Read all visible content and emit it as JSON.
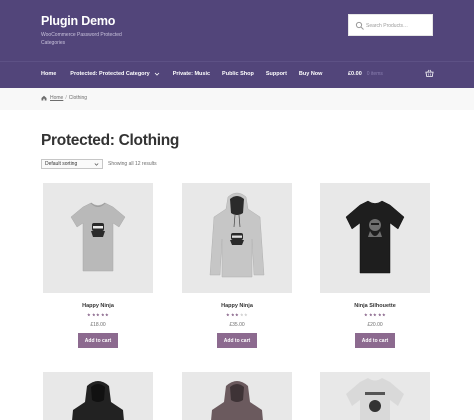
{
  "site": {
    "title": "Plugin Demo",
    "description": "WooCommerce Password Protected Categories"
  },
  "search": {
    "placeholder": "Search Products…"
  },
  "nav": {
    "items": [
      {
        "label": "Home"
      },
      {
        "label": "Protected: Protected Category",
        "has_dropdown": true
      },
      {
        "label": "Private: Music"
      },
      {
        "label": "Public Shop"
      },
      {
        "label": "Support"
      },
      {
        "label": "Buy Now"
      }
    ]
  },
  "cart": {
    "total": "£0.00",
    "count": "0 items",
    "icon": "basket-icon"
  },
  "breadcrumb": {
    "home": "Home",
    "separator": "/",
    "current": "Clothing"
  },
  "page": {
    "title": "Protected: Clothing"
  },
  "sorting": {
    "selected": "Default sorting",
    "result_count": "Showing all 12 results"
  },
  "products": [
    {
      "name": "Happy Ninja",
      "price": "£18.00",
      "rating": 5,
      "button": "Add to cart",
      "shirt_color": "#b9b9b9",
      "type": "tshirt"
    },
    {
      "name": "Happy Ninja",
      "price": "£35.00",
      "rating": 3,
      "button": "Add to cart",
      "shirt_color": "#c6c6c6",
      "type": "hoodie"
    },
    {
      "name": "Ninja Silhouette",
      "price": "£20.00",
      "rating": 5,
      "button": "Add to cart",
      "shirt_color": "#1e1e1e",
      "type": "tshirt"
    }
  ],
  "row2_products": [
    {
      "type": "hoodie",
      "shirt_color": "#222222"
    },
    {
      "type": "hoodie",
      "shirt_color": "#6b5a5e"
    },
    {
      "type": "tshirt",
      "shirt_color": "#d9d9d9"
    }
  ],
  "colors": {
    "header_bg": "#52457a",
    "button_bg": "#8c6a8f",
    "star_filled": "#8c6a8f",
    "star_empty": "#d0d0d0"
  }
}
